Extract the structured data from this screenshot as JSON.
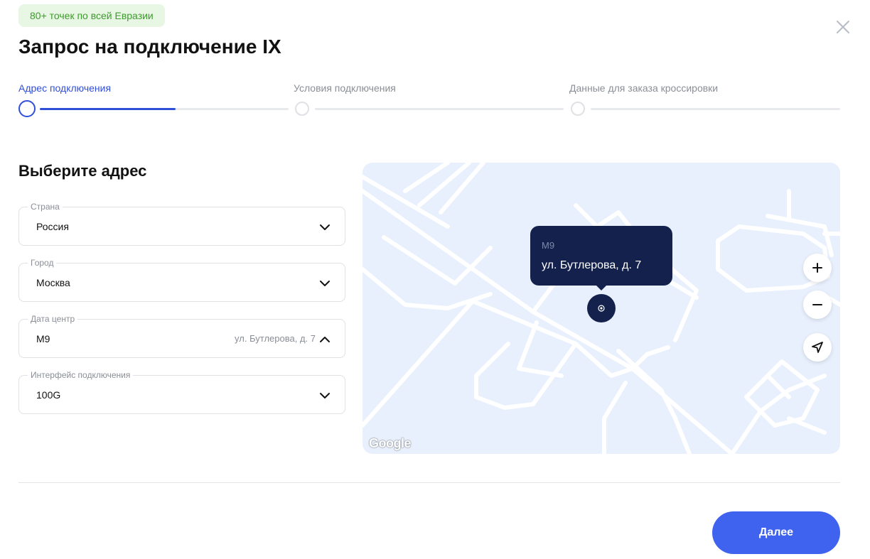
{
  "badge": "80+ точек по всей Евразии",
  "title": "Запрос на подключение IX",
  "steps": [
    {
      "label": "Адрес подключения",
      "active": true
    },
    {
      "label": "Условия подключения",
      "active": false
    },
    {
      "label": "Данные для заказа кроссировки",
      "active": false
    }
  ],
  "form": {
    "section_title": "Выберите адрес",
    "country": {
      "label": "Страна",
      "value": "Россия"
    },
    "city": {
      "label": "Город",
      "value": "Москва"
    },
    "datacenter": {
      "label": "Дата центр",
      "value": "M9",
      "hint": "ул. Бутлерова, д. 7"
    },
    "interface": {
      "label": "Интерфейс подключения",
      "value": "100G"
    }
  },
  "map": {
    "popup_name": "M9",
    "popup_address": "ул. Бутлерова, д. 7",
    "provider_logo": "Google"
  },
  "buttons": {
    "next": "Далее"
  },
  "colors": {
    "accent": "#3f63ee",
    "step_active": "#2f4fd8",
    "popup_bg": "#13214c",
    "badge_bg": "#e8f6e4",
    "badge_text": "#3e9b2e"
  },
  "icons": [
    "close-icon",
    "chevron-down-icon",
    "chevron-up-icon",
    "zoom-in-icon",
    "zoom-out-icon",
    "locate-icon",
    "location-marker-icon"
  ]
}
